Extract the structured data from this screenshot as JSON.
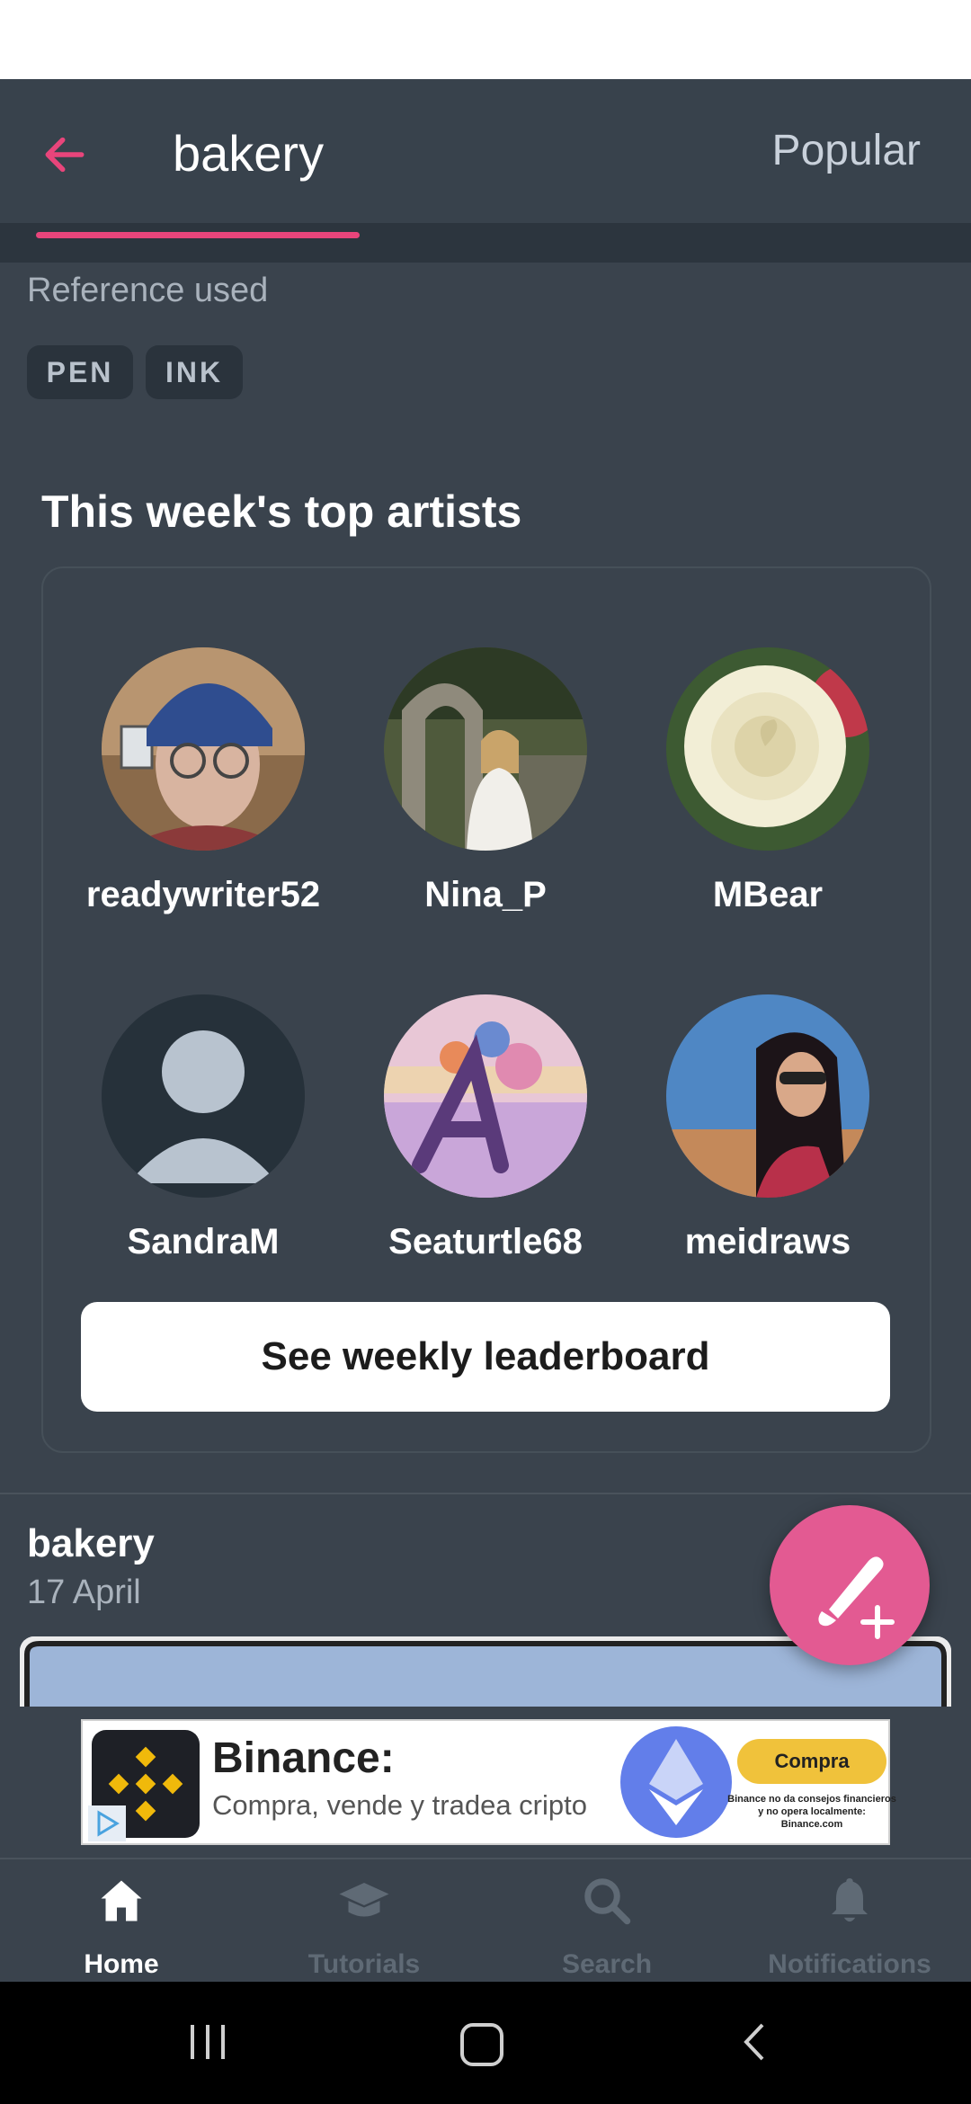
{
  "header": {
    "title": "bakery",
    "popular_label": "Popular"
  },
  "reference": {
    "label": "Reference used",
    "tags": [
      "PEN",
      "INK"
    ]
  },
  "top_artists": {
    "title": "This week's top artists",
    "artists": [
      {
        "name": "readywriter52",
        "avatar": "photo-man-blue-beanie"
      },
      {
        "name": "Nina_P",
        "avatar": "photo-woman-archway"
      },
      {
        "name": "MBear",
        "avatar": "photo-white-rose"
      },
      {
        "name": "SandraM",
        "avatar": "default-user-icon"
      },
      {
        "name": "Seaturtle68",
        "avatar": "drawing-letter-a-flowers"
      },
      {
        "name": "meidraws",
        "avatar": "photo-woman-sunglasses-beach"
      }
    ],
    "leaderboard_button": "See weekly leaderboard"
  },
  "post": {
    "title": "bakery",
    "date": "17 April"
  },
  "ad": {
    "brand": "Binance:",
    "subtitle": "Compra, vende y tradea cripto",
    "cta": "Compra",
    "disclaimer": "Binance no da consejos financieros y no opera localmente: Binance.com"
  },
  "nav": {
    "items": [
      {
        "label": "Home",
        "icon": "home-icon",
        "active": true
      },
      {
        "label": "Tutorials",
        "icon": "graduation-cap-icon",
        "active": false
      },
      {
        "label": "Search",
        "icon": "search-icon",
        "active": false
      },
      {
        "label": "Notifications",
        "icon": "bell-icon",
        "active": false
      }
    ]
  },
  "colors": {
    "accent": "#e8457b",
    "fab": "#e35a92",
    "background": "#3a434d",
    "header": "#38424c"
  }
}
